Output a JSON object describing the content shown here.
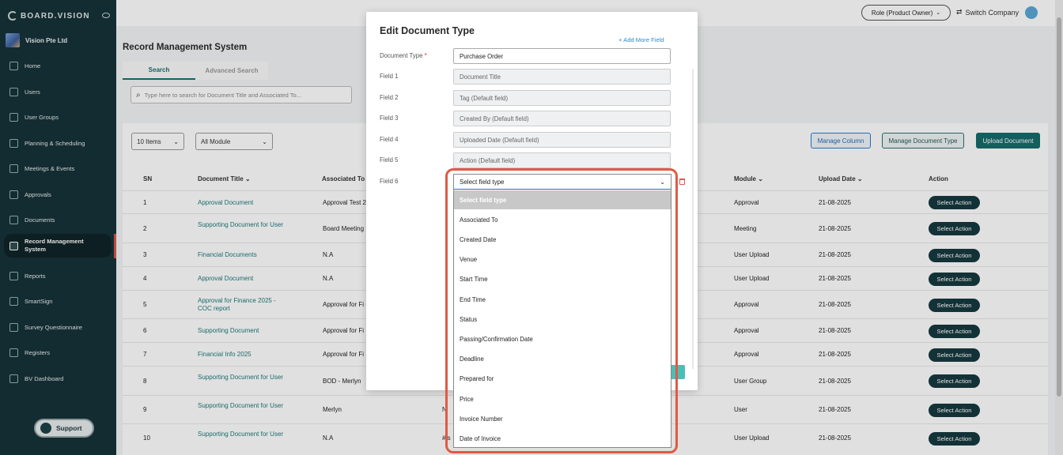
{
  "sidebar": {
    "logo": "BOARD.VISION",
    "org_name": "Vision Pte Ltd",
    "items": [
      {
        "label": "Home",
        "icon": "home-icon"
      },
      {
        "label": "Users",
        "icon": "user-icon"
      },
      {
        "label": "User Groups",
        "icon": "users-icon"
      },
      {
        "label": "Planning & Scheduling",
        "icon": "chart-icon"
      },
      {
        "label": "Meetings & Events",
        "icon": "calendar-icon"
      },
      {
        "label": "Approvals",
        "icon": "approval-icon"
      },
      {
        "label": "Documents",
        "icon": "documents-icon"
      },
      {
        "label": "Record Management System",
        "icon": "record-icon"
      },
      {
        "label": "Reports",
        "icon": "report-icon"
      },
      {
        "label": "SmartSign",
        "icon": "signature-icon"
      },
      {
        "label": "Survey Questionnaire",
        "icon": "survey-icon"
      },
      {
        "label": "Registers",
        "icon": "register-icon"
      },
      {
        "label": "BV Dashboard",
        "icon": "dashboard-icon"
      }
    ],
    "support_label": "Support"
  },
  "topbar": {
    "role_label": "Role (Product Owner)",
    "switch_company": "Switch Company"
  },
  "page": {
    "title": "Record Management System",
    "tabs": [
      "Search",
      "Advanced Search"
    ],
    "search_placeholder": "Type here to search for Document Title and Associated To...",
    "items_select": "10 Items",
    "module_select": "All Module",
    "buttons": {
      "manage_column": "Manage Column",
      "manage_doc_type": "Manage Document Type",
      "upload_document": "Upload Document"
    },
    "columns": {
      "sn": "SN",
      "title": "Document Title",
      "assoc": "Associated To",
      "module": "Module",
      "upload_date": "Upload Date",
      "action": "Action"
    },
    "rows": [
      {
        "sn": "1",
        "title": "Approval Document",
        "assoc": "Approval Test 2",
        "mid": "",
        "module": "Approval",
        "date": "21-08-2025",
        "action": "Select Action"
      },
      {
        "sn": "2",
        "title": "Supporting Document for User",
        "assoc": "Board Meeting",
        "mid": "",
        "module": "Meeting",
        "date": "21-08-2025",
        "action": "Select Action"
      },
      {
        "sn": "3",
        "title": "Financial Documents",
        "assoc": "N.A",
        "mid": "",
        "module": "User Upload",
        "date": "21-08-2025",
        "action": "Select Action"
      },
      {
        "sn": "4",
        "title": "Approval Document",
        "assoc": "N.A",
        "mid": "",
        "module": "User Upload",
        "date": "21-08-2025",
        "action": "Select Action"
      },
      {
        "sn": "5",
        "title": "Approval for Finance 2025 - COC report",
        "assoc": "Approval for Fi",
        "mid": "",
        "module": "Approval",
        "date": "21-08-2025",
        "action": "Select Action"
      },
      {
        "sn": "6",
        "title": "Supporting Document",
        "assoc": "Approval for Fi",
        "mid": "",
        "module": "Approval",
        "date": "21-08-2025",
        "action": "Select Action"
      },
      {
        "sn": "7",
        "title": "Financial Info 2025",
        "assoc": "Approval for Fi",
        "mid": "",
        "module": "Approval",
        "date": "21-08-2025",
        "action": "Select Action"
      },
      {
        "sn": "8",
        "title": "Supporting Document for User",
        "assoc": "BOD - Merlyn",
        "mid": "",
        "module": "User Group",
        "date": "21-08-2025",
        "action": "Select Action"
      },
      {
        "sn": "9",
        "title": "Supporting Document for User",
        "assoc": "Merlyn",
        "mid": "N",
        "module": "User",
        "date": "21-08-2025",
        "action": "Select Action"
      },
      {
        "sn": "10",
        "title": "Supporting Document for User",
        "assoc": "N.A",
        "mid": "# s",
        "module": "User Upload",
        "date": "21-08-2025",
        "action": "Select Action"
      }
    ]
  },
  "modal": {
    "title": "Edit Document Type",
    "add_more": "+ Add More Field",
    "doc_type_label": "Document Type",
    "doc_type_value": "Purchase Order",
    "fields": [
      {
        "label": "Field 1",
        "value": "Document Title"
      },
      {
        "label": "Field 2",
        "value": "Tag (Default field)"
      },
      {
        "label": "Field 3",
        "value": "Created By (Default field)"
      },
      {
        "label": "Field 4",
        "value": "Uploaded Date (Default field)"
      },
      {
        "label": "Field 5",
        "value": "Action (Default field)"
      }
    ],
    "field6_label": "Field 6",
    "field6_value": "Select field type",
    "dropdown_options": [
      "Select field type",
      "Associated To",
      "Created Date",
      "Venue",
      "Start Time",
      "End Time",
      "Status",
      "Passing/Confirmation Date",
      "Deadline",
      "Prepared for",
      "Price",
      "Invoice Number",
      "Date of Invoice"
    ]
  },
  "colors": {
    "sidebar_bg": "#163338",
    "accent_teal": "#197070",
    "highlight": "#e05a45",
    "action_button": "#163a3f"
  }
}
